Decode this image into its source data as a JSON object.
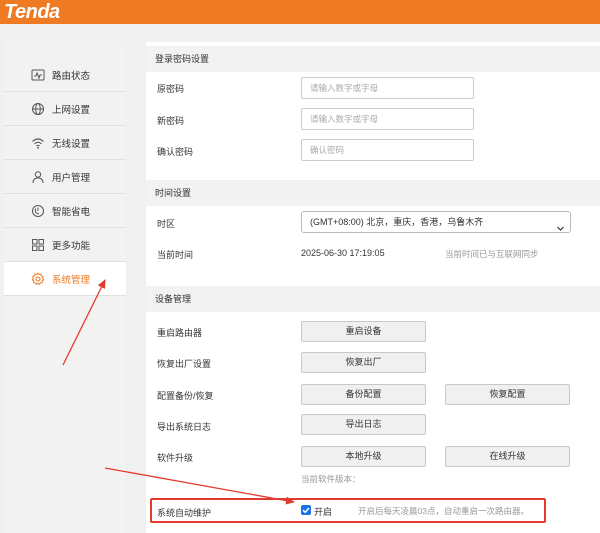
{
  "header": {
    "brand": "Tenda",
    "brand_color": "#ee7a24"
  },
  "sidebar": {
    "items": [
      {
        "label": "路由状态",
        "icon": "pulse-icon"
      },
      {
        "label": "上网设置",
        "icon": "globe-icon"
      },
      {
        "label": "无线设置",
        "icon": "wifi-icon"
      },
      {
        "label": "用户管理",
        "icon": "user-icon"
      },
      {
        "label": "智能省电",
        "icon": "power-icon"
      },
      {
        "label": "更多功能",
        "icon": "grid-icon"
      },
      {
        "label": "系统管理",
        "icon": "gear-icon",
        "active": true
      }
    ]
  },
  "password": {
    "title": "登录密码设置",
    "old_label": "原密码",
    "old_placeholder": "请输入数字或字母",
    "new_label": "新密码",
    "new_placeholder": "请输入数字或字母",
    "confirm_label": "确认密码",
    "confirm_placeholder": "确认密码"
  },
  "time": {
    "title": "时间设置",
    "zone_label": "时区",
    "zone_value": "(GMT+08:00) 北京，重庆，香港，乌鲁木齐",
    "now_label": "当前时间",
    "now_value": "2025-06-30 17:19:05",
    "sync_hint": "当前时间已与互联网同步"
  },
  "device": {
    "title": "设备管理",
    "reboot_label": "重启路由器",
    "reboot_btn": "重启设备",
    "reset_label": "恢复出厂设置",
    "reset_btn": "恢复出厂",
    "backup_label": "配置备份/恢复",
    "backup_btn": "备份配置",
    "restore_btn": "恢复配置",
    "log_label": "导出系统日志",
    "log_btn": "导出日志",
    "upgrade_label": "软件升级",
    "local_btn": "本地升级",
    "online_btn": "在线升级",
    "version_label": "当前软件版本：",
    "maint_label": "系统自动维护",
    "maint_check_label": "开启",
    "maint_checked": true,
    "maint_hint": "开启后每天凌晨03点，自动重启一次路由器。"
  },
  "annotation_color": "#e23a2e"
}
